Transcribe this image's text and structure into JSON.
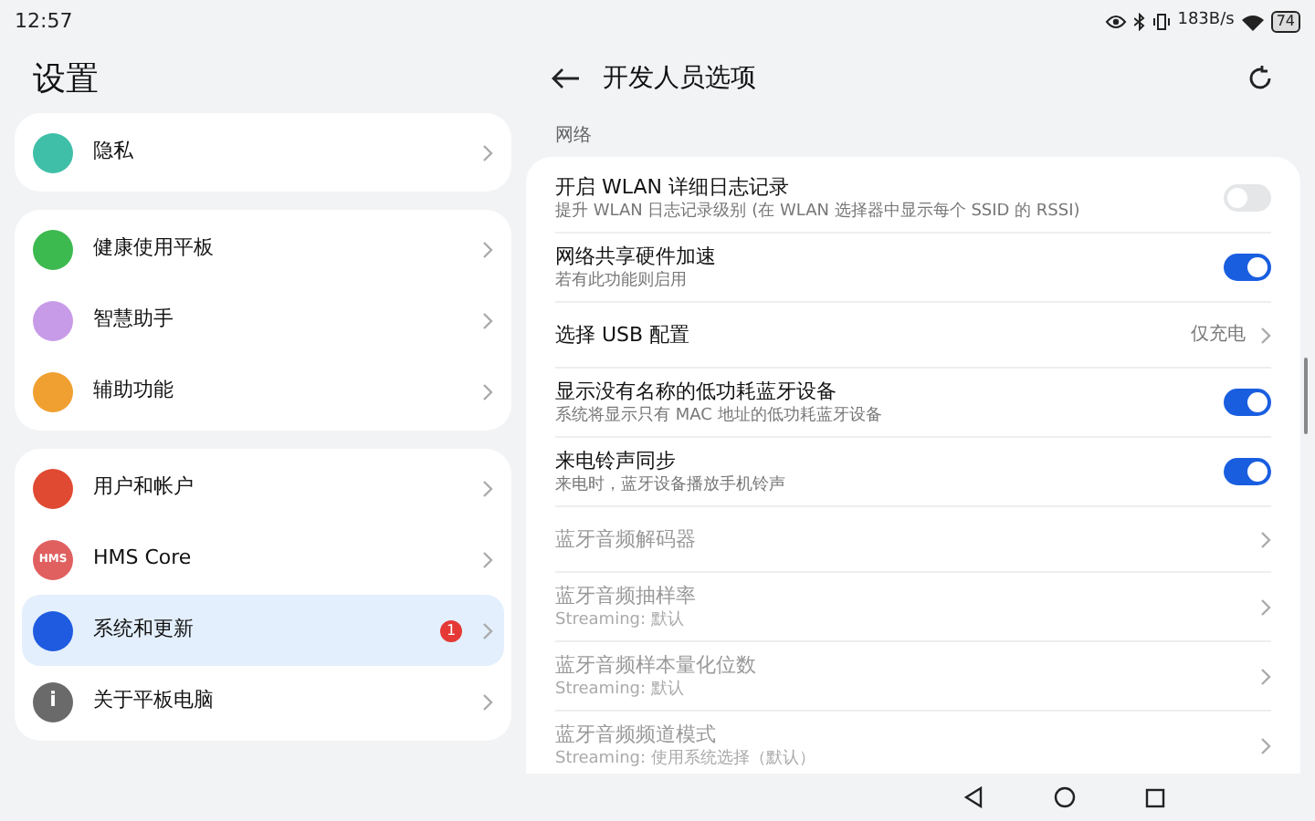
{
  "status_bar": {
    "time": "12:57",
    "speed": "183B/s",
    "battery": "74"
  },
  "sidebar": {
    "title": "设置",
    "groups": [
      [
        {
          "label": "隐私",
          "color": "#3fbfa8",
          "selected": false
        }
      ],
      [
        {
          "label": "健康使用平板",
          "color": "#3cb94f",
          "selected": false
        },
        {
          "label": "智慧助手",
          "color": "#c89be8",
          "selected": false
        },
        {
          "label": "辅助功能",
          "color": "#f0a030",
          "selected": false
        }
      ],
      [
        {
          "label": "用户和帐户",
          "color": "#e04a32",
          "selected": false
        },
        {
          "label": "HMS Core",
          "color": "#e06060",
          "icon_text": "HMS",
          "selected": false
        },
        {
          "label": "系统和更新",
          "color": "#1e5be0",
          "badge": "1",
          "selected": true
        },
        {
          "label": "关于平板电脑",
          "color": "#6a6a6a",
          "icon_text": "i",
          "selected": false
        }
      ]
    ]
  },
  "page": {
    "title": "开发人员选项",
    "section": "网络",
    "rows": [
      {
        "kind": "toggle",
        "title": "开启 WLAN 详细日志记录",
        "subtitle": "提升 WLAN 日志记录级别 (在 WLAN 选择器中显示每个 SSID 的 RSSI)",
        "on": false,
        "disabled": false
      },
      {
        "kind": "toggle",
        "title": "网络共享硬件加速",
        "subtitle": "若有此功能则启用",
        "on": true,
        "disabled": false
      },
      {
        "kind": "value",
        "title": "选择 USB 配置",
        "value": "仅充电",
        "disabled": false
      },
      {
        "kind": "toggle",
        "title": "显示没有名称的低功耗蓝牙设备",
        "subtitle": "系统将显示只有 MAC 地址的低功耗蓝牙设备",
        "on": true,
        "disabled": false
      },
      {
        "kind": "toggle",
        "title": "来电铃声同步",
        "subtitle": "来电时，蓝牙设备播放手机铃声",
        "on": true,
        "disabled": false
      },
      {
        "kind": "link",
        "title": "蓝牙音频解码器",
        "disabled": true
      },
      {
        "kind": "link",
        "title": "蓝牙音频抽样率",
        "subtitle": "Streaming: 默认",
        "disabled": true
      },
      {
        "kind": "link",
        "title": "蓝牙音频样本量化位数",
        "subtitle": "Streaming: 默认",
        "disabled": true
      },
      {
        "kind": "link",
        "title": "蓝牙音频频道模式",
        "subtitle": "Streaming: 使用系统选择（默认）",
        "disabled": true
      }
    ]
  }
}
